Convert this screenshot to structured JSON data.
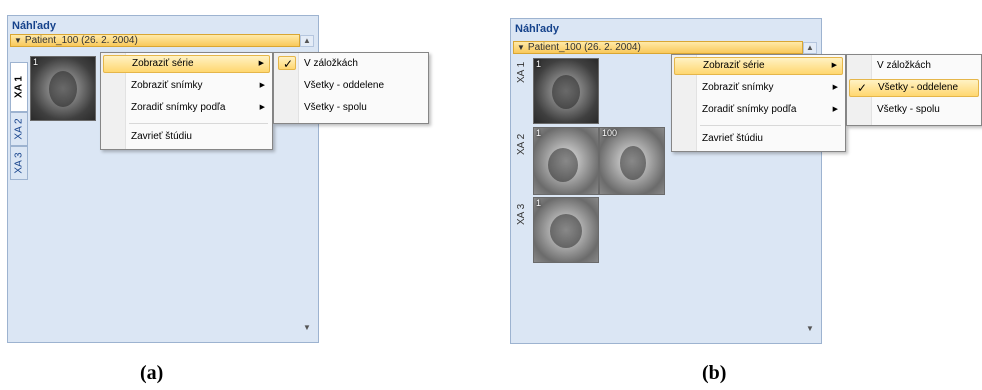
{
  "captions": {
    "a": "(a)",
    "b": "(b)"
  },
  "panel_a": {
    "title": "Náhľady",
    "patient": "Patient_100 (26. 2. 2004)",
    "tabs": [
      "XA 1",
      "XA 2",
      "XA 3"
    ],
    "thumb_number": "1",
    "context_menu": [
      "Zobraziť série",
      "Zobraziť snímky",
      "Zoradiť snímky podľa",
      "Zavrieť štúdiu"
    ],
    "submenu": [
      "V záložkách",
      "Všetky - oddelene",
      "Všetky - spolu"
    ],
    "checked": "✓"
  },
  "panel_b": {
    "title": "Náhľady",
    "patient": "Patient_100 (26. 2. 2004)",
    "series": [
      {
        "label": "XA 1",
        "numbers": [
          "1"
        ]
      },
      {
        "label": "XA 2",
        "numbers": [
          "1",
          "100"
        ]
      },
      {
        "label": "XA 3",
        "numbers": [
          "1"
        ]
      }
    ],
    "context_menu": [
      "Zobraziť série",
      "Zobraziť snímky",
      "Zoradiť snímky podľa",
      "Zavrieť štúdiu"
    ],
    "submenu": [
      "V záložkách",
      "Všetky - oddelene",
      "Všetky - spolu"
    ],
    "checked": "✓"
  },
  "icons": {
    "expand": "triangle-down-icon",
    "submenu": "triangle-right-icon",
    "scroll_up": "scroll-up-icon",
    "scroll_down": "scroll-down-icon",
    "check": "check-icon"
  }
}
